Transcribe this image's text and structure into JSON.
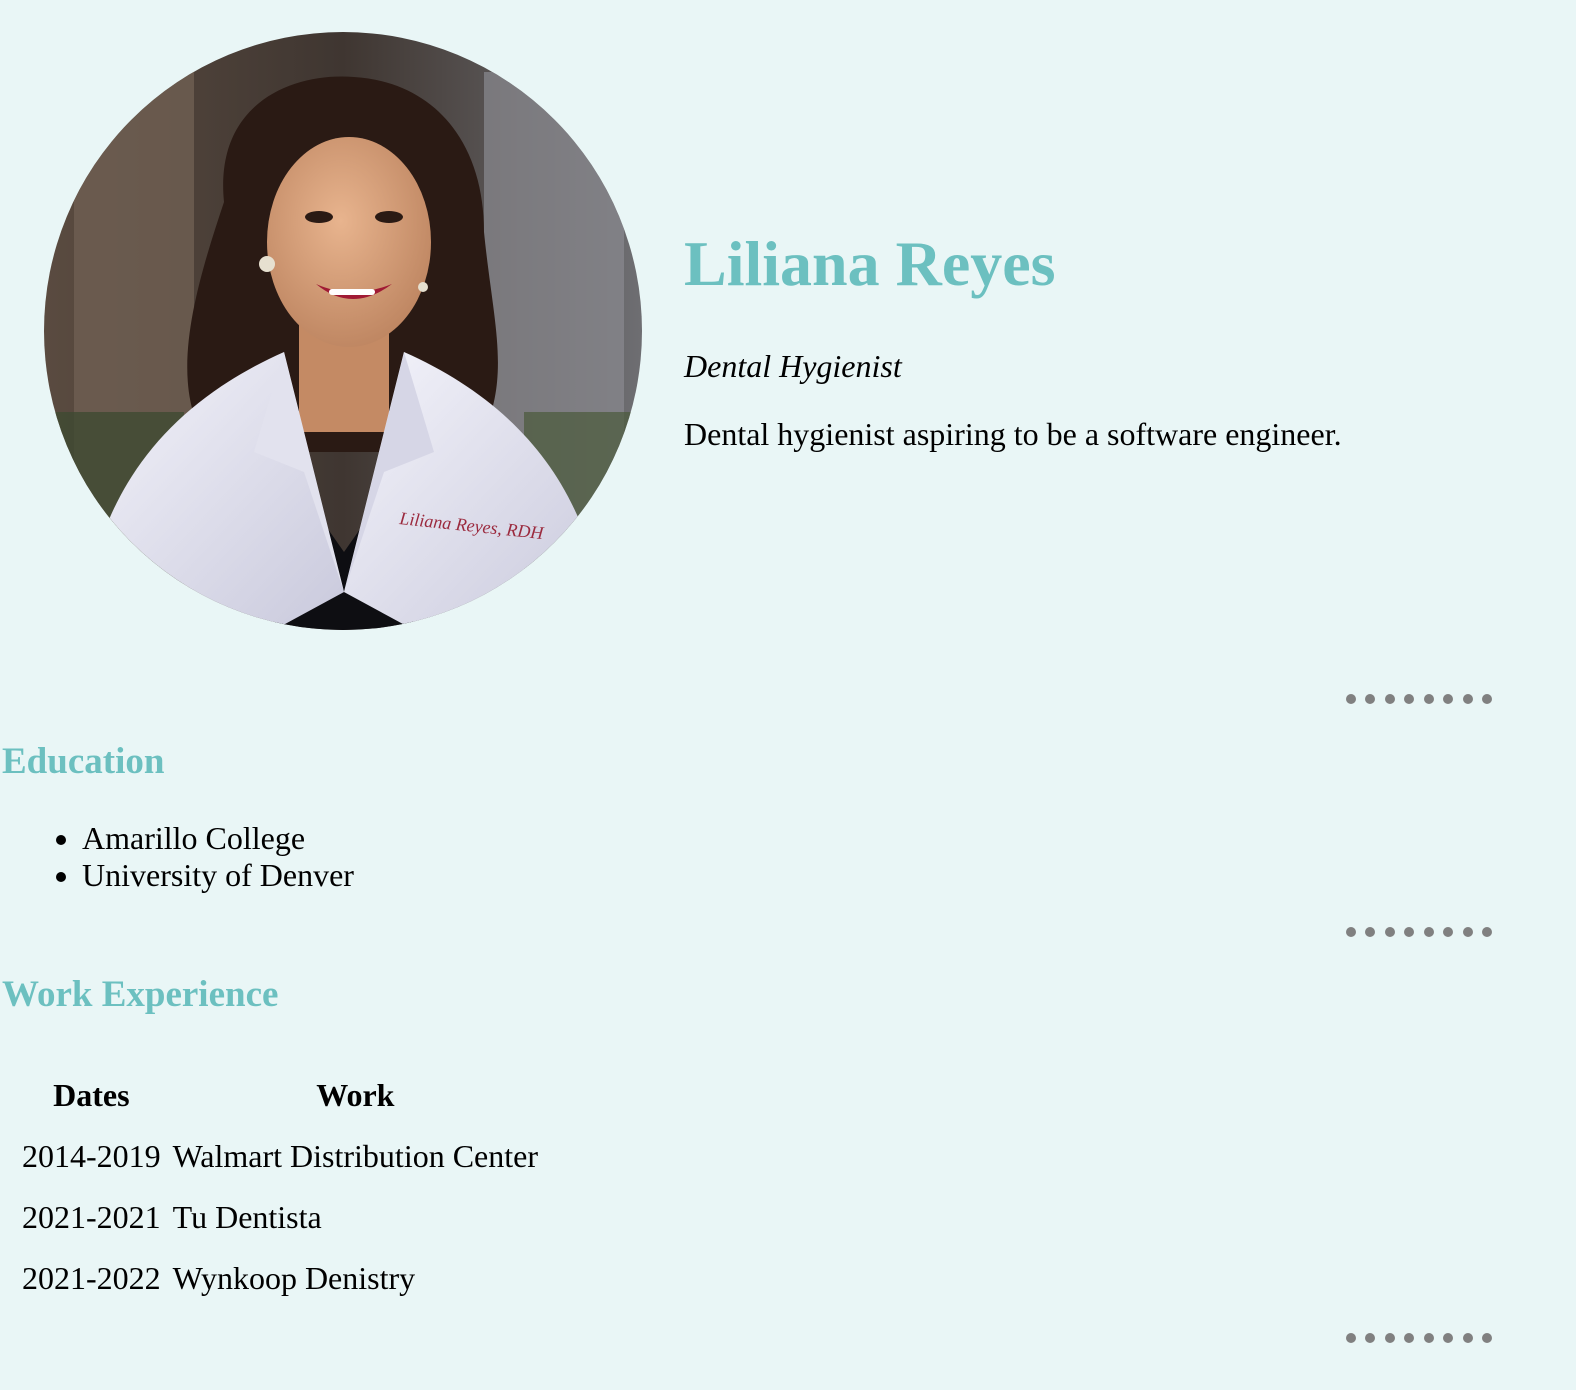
{
  "profile": {
    "name": "Liliana Reyes",
    "title": "Dental Hygienist",
    "bio": "Dental hygienist aspiring to be a software engineer.",
    "photo_alt": "Liliana Reyes"
  },
  "education": {
    "heading": "Education",
    "items": [
      {
        "label": "Amarillo College"
      },
      {
        "label": "University of Denver"
      }
    ]
  },
  "work": {
    "heading": "Work Experience",
    "columns": [
      "Dates",
      "Work"
    ],
    "rows": [
      {
        "dates": "2014-2019",
        "work": "Walmart Distribution Center"
      },
      {
        "dates": "2021-2021",
        "work": "Tu Dentista"
      },
      {
        "dates": "2021-2022",
        "work": "Wynkoop Denistry"
      }
    ]
  },
  "photo_badge": "Liliana Reyes, RDH",
  "colors": {
    "background": "#e9f6f6",
    "heading": "#6cc0c0",
    "divider_dots": "#808080"
  }
}
